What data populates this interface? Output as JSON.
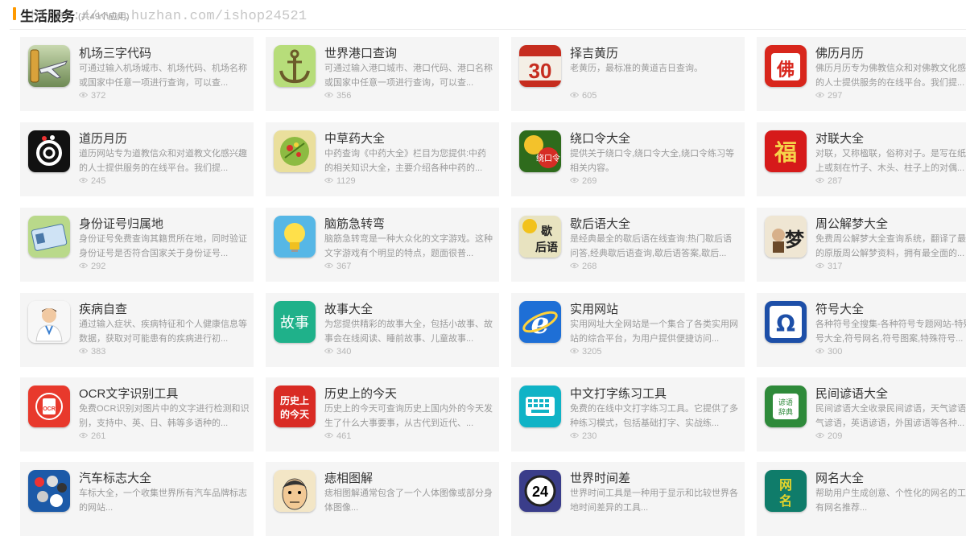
{
  "watermark": "https://www.huzhan.com/ishop24521",
  "section": {
    "title": "生活服务",
    "count": "(共49个应用)"
  },
  "apps": [
    {
      "name": "机场三字代码",
      "desc": "可通过输入机场城市、机场代码、机场名称或国家中任意一项进行查询，可以查...",
      "views": "372",
      "icon": "airplane-icon"
    },
    {
      "name": "世界港口查询",
      "desc": "可通过输入港口城市、港口代码、港口名称或国家中任意一项进行查询，可以查...",
      "views": "356",
      "icon": "anchor-icon"
    },
    {
      "name": "择吉黄历",
      "desc": "老黄历，最标准的黄道吉日查询。",
      "views": "605",
      "icon": "calendar-30-icon"
    },
    {
      "name": "佛历月历",
      "desc": "佛历月历专为佛教信众和对佛教文化感兴趣的人士提供服务的在线平台。我们提...",
      "views": "297",
      "icon": "buddha-calendar-icon"
    },
    {
      "name": "道历月历",
      "desc": "道历网站专为道教信众和对道教文化感兴趣的人士提供服务的在线平台。我们提...",
      "views": "245",
      "icon": "taoism-icon"
    },
    {
      "name": "中草药大全",
      "desc": "中药查询《中药大全》栏目为您提供:中药的相关知识大全，主要介绍各种中药的...",
      "views": "1129",
      "icon": "herb-icon"
    },
    {
      "name": "绕口令大全",
      "desc": "提供关于绕口令,绕口令大全,绕口令练习等相关内容。",
      "views": "269",
      "icon": "tongue-twister-icon"
    },
    {
      "name": "对联大全",
      "desc": "对联，又称楹联，俗称对子。是写在纸、布上或刻在竹子、木头、柱子上的对偶...",
      "views": "287",
      "icon": "couplet-icon"
    },
    {
      "name": "身份证号归属地",
      "desc": "身份证号免费查询其籍贯所在地，同时验证身份证号是否符合国家关于身份证号...",
      "views": "292",
      "icon": "id-card-icon"
    },
    {
      "name": "脑筋急转弯",
      "desc": "脑筋急转弯是一种大众化的文字游戏。这种文字游戏有个明显的特点，题面很普...",
      "views": "367",
      "icon": "lightbulb-icon"
    },
    {
      "name": "歇后语大全",
      "desc": "是经典最全的歇后语在线查询:热门歇后语问答,经典歇后语查询,歇后语答案,歇后...",
      "views": "268",
      "icon": "xiehouyu-icon"
    },
    {
      "name": "周公解梦大全",
      "desc": "免费周公解梦大全查询系统，翻译了最权威的原版周公解梦资料，拥有最全面的...",
      "views": "317",
      "icon": "dream-icon"
    },
    {
      "name": "疾病自查",
      "desc": "通过输入症状、疾病特征和个人健康信息等数据，获取对可能患有的疾病进行初...",
      "views": "383",
      "icon": "doctor-icon"
    },
    {
      "name": "故事大全",
      "desc": "为您提供精彩的故事大全，包括小故事、故事会在线阅读、睡前故事、儿童故事...",
      "views": "340",
      "icon": "story-icon"
    },
    {
      "name": "实用网站",
      "desc": "实用网址大全网站是一个集合了各类实用网站的综合平台，为用户提供便捷访问...",
      "views": "3205",
      "icon": "ie-icon"
    },
    {
      "name": "符号大全",
      "desc": "各种符号全搜集-各种符号专题网站-特殊符号大全,符号网名,符号图案,特殊符号...",
      "views": "300",
      "icon": "omega-icon"
    },
    {
      "name": "OCR文字识别工具",
      "desc": "免费OCR识别对图片中的文字进行检测和识别，支持中、英、日、韩等多语种的...",
      "views": "261",
      "icon": "ocr-icon"
    },
    {
      "name": "历史上的今天",
      "desc": "历史上的今天可查询历史上国内外的今天发生了什么大事要事，从古代到近代、...",
      "views": "461",
      "icon": "history-today-icon"
    },
    {
      "name": "中文打字练习工具",
      "desc": "免费的在线中文打字练习工具。它提供了多种练习模式，包括基础打字、实战练...",
      "views": "230",
      "icon": "keyboard-icon"
    },
    {
      "name": "民间谚语大全",
      "desc": "民间谚语大全收录民间谚语，天气谚语、节气谚语，英语谚语，外国谚语等各种...",
      "views": "209",
      "icon": "proverb-icon"
    },
    {
      "name": "汽车标志大全",
      "desc": "车标大全，一个收集世界所有汽车品牌标志的网站...",
      "views": "",
      "icon": "car-logo-icon"
    },
    {
      "name": "痣相图解",
      "desc": "痣相图解通常包含了一个人体图像或部分身体图像...",
      "views": "",
      "icon": "mole-face-icon"
    },
    {
      "name": "世界时间差",
      "desc": "世界时间工具是一种用于显示和比较世界各地时间差异的工具...",
      "views": "",
      "icon": "clock-24-icon"
    },
    {
      "name": "网名大全",
      "desc": "帮助用户生成创意、个性化的网名的工具，有网名推荐...",
      "views": "",
      "icon": "nickname-icon"
    }
  ]
}
